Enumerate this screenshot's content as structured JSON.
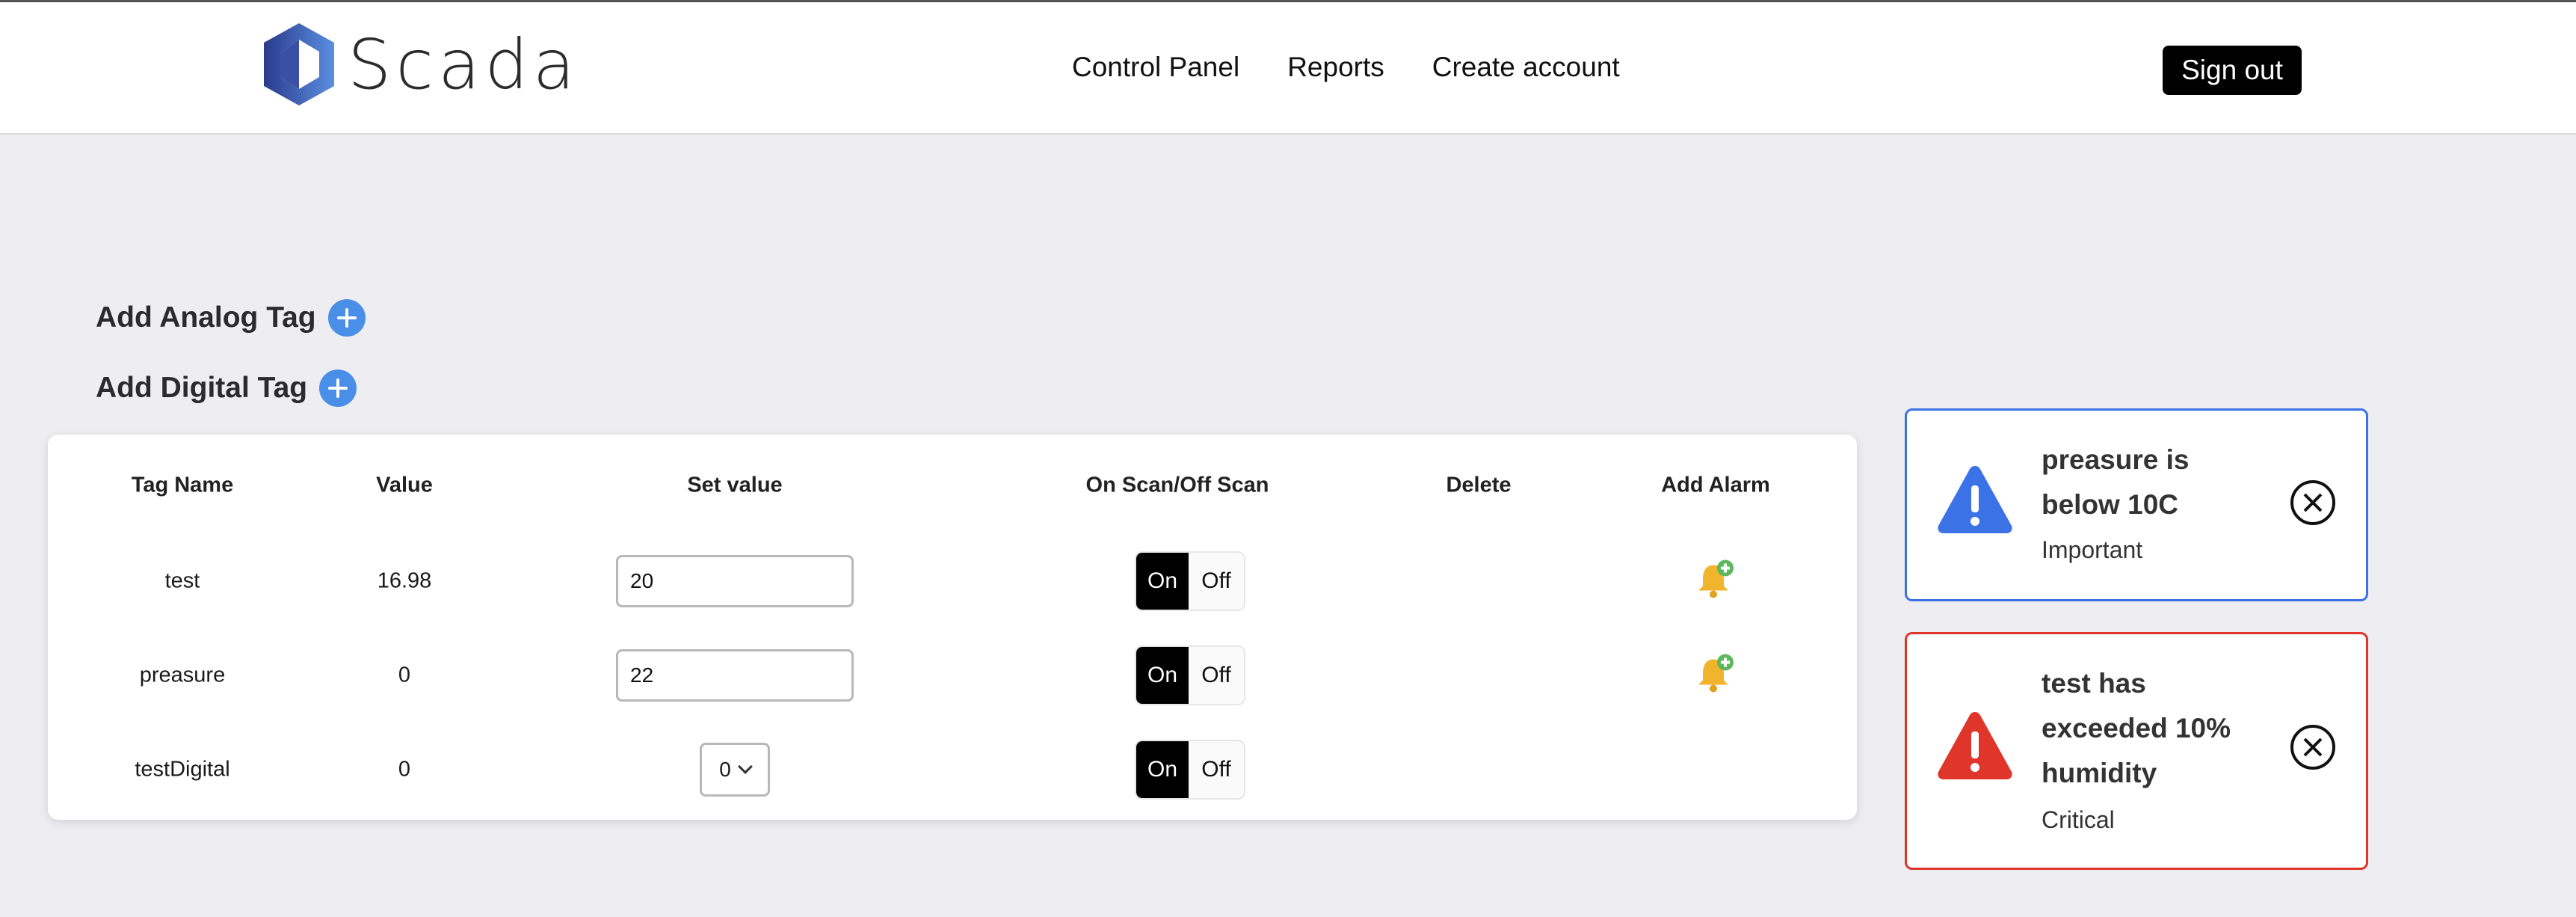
{
  "header": {
    "logo_text": "Scada",
    "nav": [
      "Control Panel",
      "Reports",
      "Create account"
    ],
    "signout_label": "Sign out"
  },
  "actions": {
    "add_analog": "Add Analog Tag",
    "add_digital": "Add Digital Tag"
  },
  "table": {
    "headers": [
      "Tag Name",
      "Value",
      "Set value",
      "On Scan/Off Scan",
      "Delete",
      "Add Alarm"
    ],
    "rows": [
      {
        "name": "test",
        "value": "16.98",
        "set_value": "20",
        "on": "On",
        "off": "Off"
      },
      {
        "name": "preasure",
        "value": "0",
        "set_value": "22",
        "on": "On",
        "off": "Off"
      },
      {
        "name": "testDigital",
        "value": "0",
        "set_value": "0",
        "on": "On",
        "off": "Off"
      }
    ]
  },
  "alarms": [
    {
      "message": [
        "preasure is",
        "below 10C"
      ],
      "severity": "Important",
      "color": "#3b73e6"
    },
    {
      "message": [
        "test has",
        "exceeded 10%",
        "humidity"
      ],
      "severity": "Critical",
      "color": "#e0352b"
    }
  ],
  "colors": {
    "accent_blue": "#4a8fe7",
    "delete_red": "#e35d4f",
    "page_bg": "#eeedf1"
  }
}
